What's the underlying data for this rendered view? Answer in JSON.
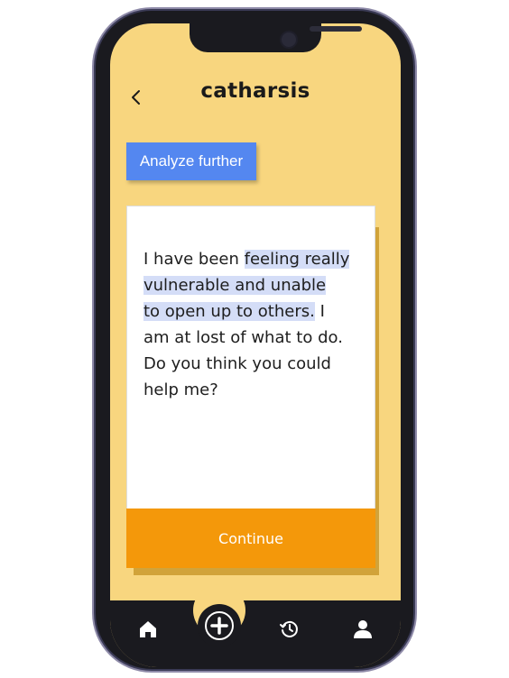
{
  "app": {
    "title": "catharsis"
  },
  "toolbar": {
    "analyze_label": "Analyze further"
  },
  "card": {
    "before": "I have been ",
    "highlighted_1": "feeling really",
    "highlighted_2": "vulnerable and unable",
    "highlighted_3": "to open up to others.",
    "after_line": " I",
    "line_4": "am at lost of what to do.",
    "line_5": "Do you think you could",
    "line_6": "help me?",
    "continue_label": "Continue"
  },
  "nav": {
    "items": [
      {
        "icon": "home-icon"
      },
      {
        "icon": "plus-icon"
      },
      {
        "icon": "history-icon"
      },
      {
        "icon": "profile-icon"
      }
    ]
  },
  "colors": {
    "background": "#f8d67f",
    "accent_blue": "#5487f0",
    "accent_orange": "#f4980a",
    "highlight": "#d4ddf7",
    "frame": "#1a1a1f"
  }
}
